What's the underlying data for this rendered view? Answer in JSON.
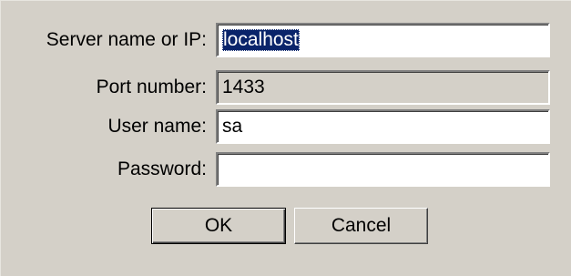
{
  "form": {
    "server": {
      "label": "Server name or IP:",
      "value": "localhost",
      "selected": true
    },
    "port": {
      "label": "Port number:",
      "value": "1433",
      "disabled": true
    },
    "user": {
      "label": "User name:",
      "value": "sa"
    },
    "password": {
      "label": "Password:",
      "value": ""
    }
  },
  "buttons": {
    "ok_label": "OK",
    "cancel_label": "Cancel"
  },
  "colors": {
    "dialog_bg": "#d4d0c8",
    "selection_bg": "#0a246a",
    "selection_fg": "#ffffff"
  }
}
